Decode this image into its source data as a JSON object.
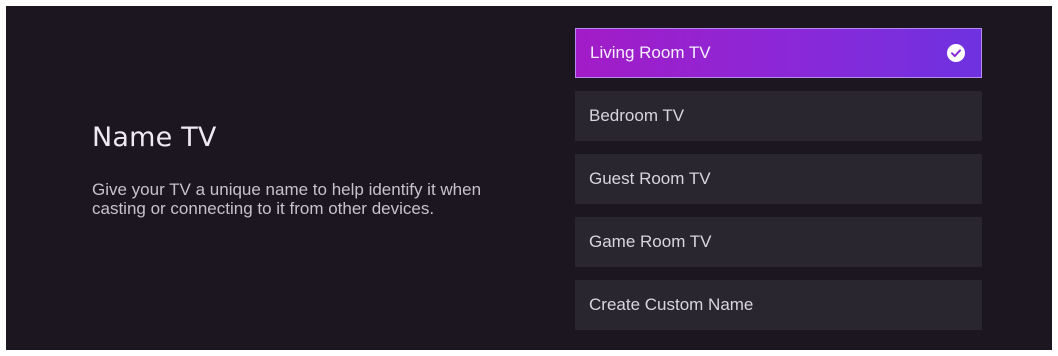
{
  "heading": {
    "title": "Name TV",
    "description": "Give your TV a unique name to help identify it when casting or connecting to it from other devices."
  },
  "options": [
    {
      "label": "Living Room TV",
      "selected": true
    },
    {
      "label": "Bedroom TV",
      "selected": false
    },
    {
      "label": "Guest Room TV",
      "selected": false
    },
    {
      "label": "Game Room TV",
      "selected": false
    },
    {
      "label": "Create Custom Name",
      "selected": false
    }
  ],
  "icons": {
    "selected_indicator": "check-circle-icon"
  },
  "colors": {
    "background": "#1b1620",
    "option_background": "#2a2630",
    "selected_gradient_start": "#a21cc7",
    "selected_gradient_end": "#6e32e0"
  }
}
